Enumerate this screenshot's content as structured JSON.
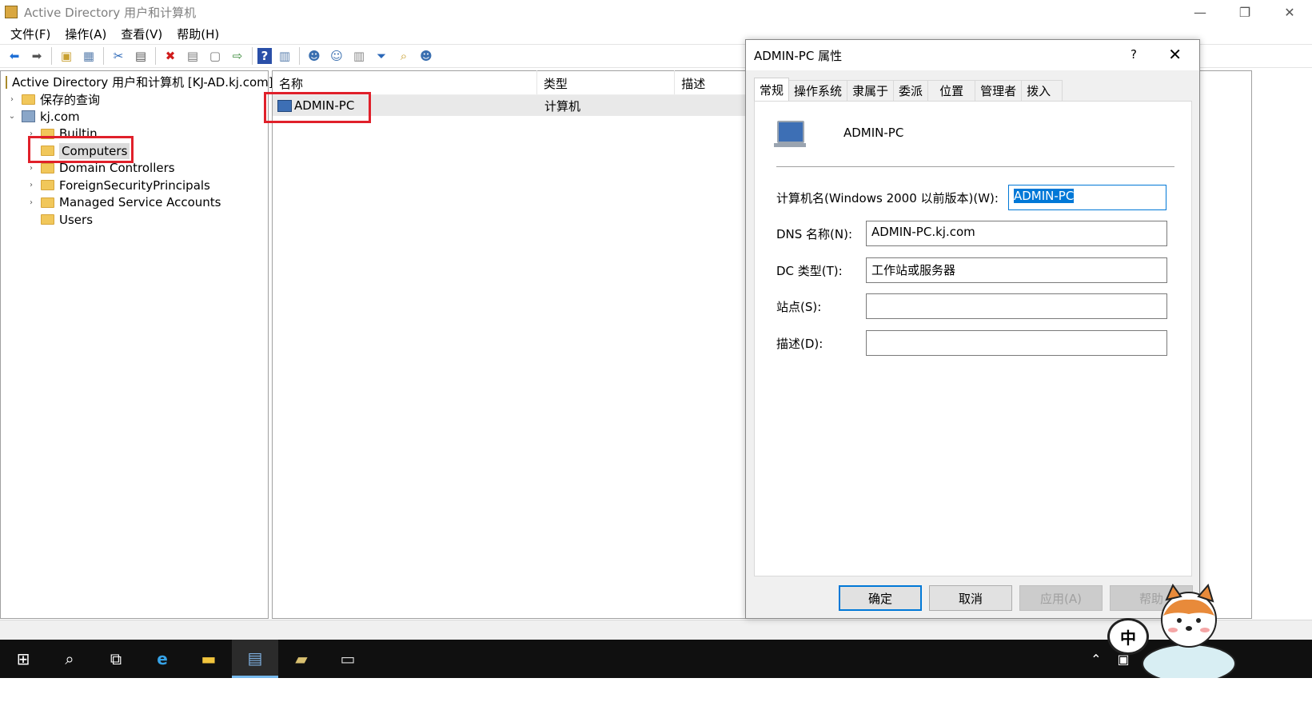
{
  "window": {
    "title": "Active Directory 用户和计算机",
    "controls": [
      "—",
      "❐",
      "✕"
    ]
  },
  "menu": [
    "文件(F)",
    "操作(A)",
    "查看(V)",
    "帮助(H)"
  ],
  "toolbar": {
    "icons": [
      "back-arrow-icon",
      "forward-arrow-icon",
      "up-folder-icon",
      "show-tree-icon",
      "cut-icon",
      "paste-icon",
      "delete-icon",
      "properties-icon",
      "refresh-icon",
      "export-icon",
      "help-icon",
      "console-icon",
      "new-user-icon",
      "new-group-icon",
      "new-ou-icon",
      "filter-icon",
      "find-icon",
      "add-to-group-icon"
    ]
  },
  "tree": {
    "root": "Active Directory 用户和计算机 [KJ-AD.kj.com]",
    "saved_queries": "保存的查询",
    "domain": "kj.com",
    "children": [
      "Builtin",
      "Computers",
      "Domain Controllers",
      "ForeignSecurityPrincipals",
      "Managed Service Accounts",
      "Users"
    ],
    "selected": "Computers"
  },
  "list": {
    "columns": [
      "名称",
      "类型",
      "描述"
    ],
    "rows": [
      {
        "name": "ADMIN-PC",
        "type": "计算机",
        "desc": ""
      }
    ]
  },
  "dialog": {
    "title": "ADMIN-PC 属性",
    "help": "?",
    "close": "✕",
    "tabs": [
      "常规",
      "操作系统",
      "隶属于",
      "委派",
      "位置",
      "管理者",
      "拨入"
    ],
    "active_tab": "常规",
    "computer_name": "ADMIN-PC",
    "fields": {
      "prewin2000_label": "计算机名(Windows 2000 以前版本)(W):",
      "prewin2000_value": "ADMIN-PC",
      "dns_label": "DNS 名称(N):",
      "dns_value": "ADMIN-PC.kj.com",
      "dc_type_label": "DC 类型(T):",
      "dc_type_value": "工作站或服务器",
      "site_label": "站点(S):",
      "site_value": "",
      "desc_label": "描述(D):",
      "desc_value": ""
    },
    "buttons": {
      "ok": "确定",
      "cancel": "取消",
      "apply": "应用(A)",
      "help": "帮助"
    }
  },
  "taskbar": {
    "ime": "中",
    "ime_bubble": "中"
  },
  "colors": {
    "highlight_box": "#e0202a",
    "selection": "#0078d7",
    "taskbar": "#101010"
  }
}
